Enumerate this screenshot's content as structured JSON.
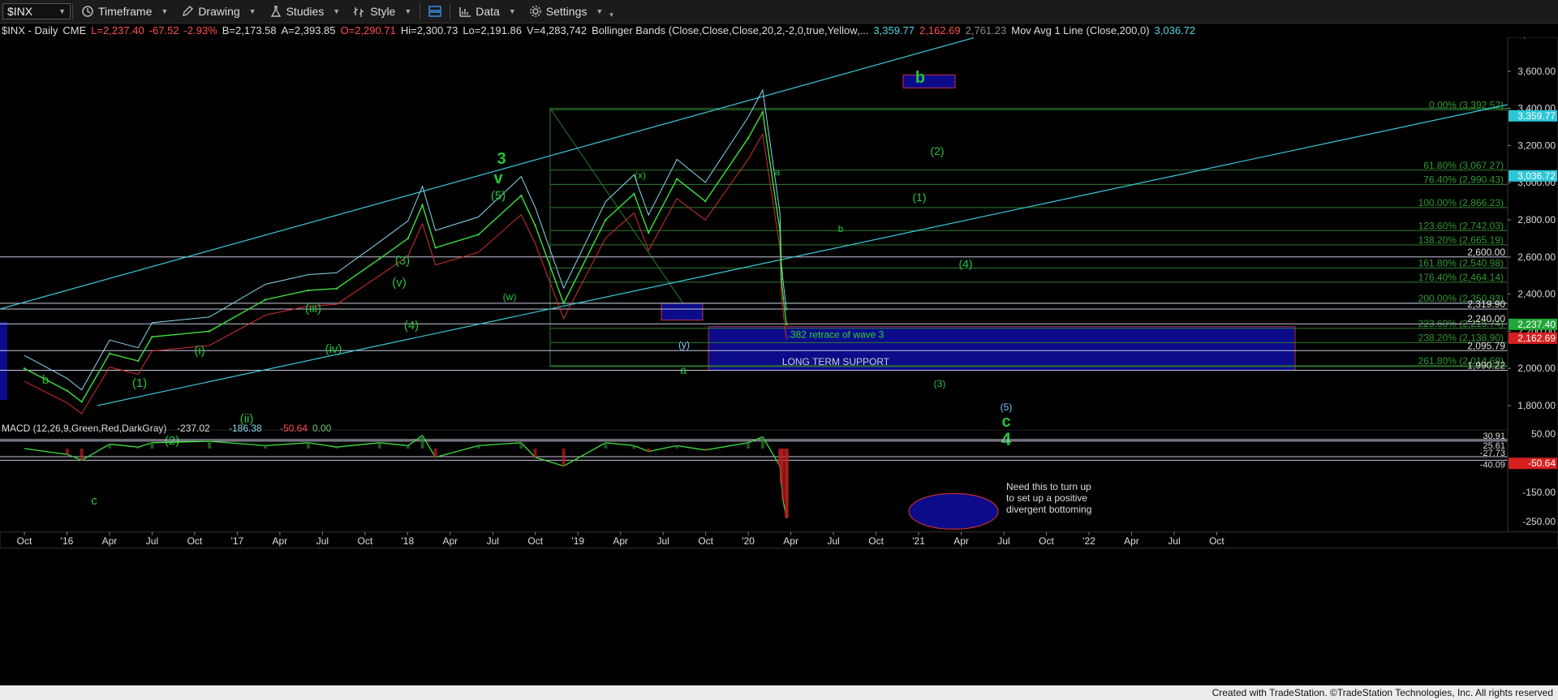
{
  "toolbar": {
    "symbol": "$INX",
    "items": [
      "Timeframe",
      "Drawing",
      "Studies",
      "Style",
      "Data",
      "Settings"
    ]
  },
  "infobar": {
    "symbol_line": "$INX - Daily",
    "exchange": "CME",
    "last": "L=2,237.40",
    "change": "-67.52",
    "change_pct": "-2.93%",
    "bid": "B=2,173.58",
    "ask": "A=2,393.85",
    "open": "O=2,290.71",
    "high": "Hi=2,300.73",
    "low": "Lo=2,191.86",
    "volume": "V=4,283,742",
    "bb_label": "Bollinger Bands (Close,Close,Close,20,2,-2,0,true,Yellow,...",
    "bb_upper": "3,359.77",
    "bb_lower": "2,162.69",
    "bb_mid": "2,761.23",
    "ma_label": "Mov Avg 1 Line (Close,200,0)",
    "ma_value": "3,036.72"
  },
  "price_axis": {
    "ticks": [
      3800,
      3600,
      3400,
      3200,
      3000,
      2800,
      2600,
      2400,
      2200,
      2000,
      1800
    ],
    "tick_labels": [
      "3,800.00",
      "3,600.00",
      "3,400.00",
      "3,200.00",
      "3,000.00",
      "2,800.00",
      "2,600.00",
      "2,400.00",
      "2,200.00",
      "2,000.00",
      "1,800.00"
    ],
    "tags": [
      {
        "value": 3359.77,
        "label": "3,359.77",
        "color": "#2ec6d6"
      },
      {
        "value": 3036.72,
        "label": "3,036.72",
        "color": "#2ec6d6"
      },
      {
        "value": 2237.4,
        "label": "2,237.40",
        "color": "#22a83a"
      },
      {
        "value": 2162.69,
        "label": "2,162.69",
        "color": "#d62020"
      }
    ]
  },
  "macd_axis": {
    "ticks": [
      50,
      -50,
      -150,
      -250
    ],
    "tick_labels": [
      "50.00",
      "-50.00",
      "-150.00",
      "-250.00"
    ],
    "level_labels": [
      "30.91",
      "25.61",
      "-27.73",
      "-40.09"
    ],
    "tag": {
      "value": -50.64,
      "label": "-50.64",
      "color": "#d62020"
    }
  },
  "time_axis": {
    "labels": [
      "Oct",
      "'16",
      "Apr",
      "Jul",
      "Oct",
      "'17",
      "Apr",
      "Jul",
      "Oct",
      "'18",
      "Apr",
      "Jul",
      "Oct",
      "'19",
      "Apr",
      "Jul",
      "Oct",
      "'20",
      "Apr",
      "Jul",
      "Oct",
      "'21",
      "Apr",
      "Jul",
      "Oct",
      "'22",
      "Apr",
      "Jul",
      "Oct"
    ]
  },
  "fib_levels": [
    {
      "label": "0.00% (3,392.52)",
      "value": 3392.52
    },
    {
      "label": "61.80% (3,067.27)",
      "value": 3067.27
    },
    {
      "label": "76.40% (2,990.43)",
      "value": 2990.43
    },
    {
      "label": "100.00% (2,866.23)",
      "value": 2866.23
    },
    {
      "label": "123.60% (2,742.03)",
      "value": 2742.03
    },
    {
      "label": "138.20% (2,665.19)",
      "value": 2665.19
    },
    {
      "label": "161.80% (2,540.98)",
      "value": 2540.98
    },
    {
      "label": "176.40% (2,464.14)",
      "value": 2464.14
    },
    {
      "label": "200.00% (2,350.93)",
      "value": 2350.93
    },
    {
      "label": "223.60% (2,215.74)",
      "value": 2215.74
    },
    {
      "label": "238.20% (2,138.90)",
      "value": 2138.9
    },
    {
      "label": "261.80% (2,014.69)",
      "value": 2014.69
    }
  ],
  "support_lines": [
    {
      "label": "2,600.00",
      "value": 2600.0
    },
    {
      "label": "2,319.90",
      "value": 2319.9
    },
    {
      "label": "2,240.00",
      "value": 2240.0
    },
    {
      "label": "2,095.79",
      "value": 2095.79
    },
    {
      "label": "1,990.22",
      "value": 1990.22
    }
  ],
  "annotations": {
    "retrace": ".382 retrace of wave 3",
    "support": "LONG TERM SUPPORT",
    "macd_note": [
      "Need this to turn up",
      "to set up a positive",
      "divergent bottoming"
    ],
    "macd_label": "MACD (12,26,9,Green,Red,DarkGray)",
    "macd_v1": "-237.02",
    "macd_v2": "-186.38",
    "macd_v3": "-50.64",
    "macd_v4": "0.00"
  },
  "wave_labels": [
    {
      "t": "3",
      "x": 618,
      "y": 202,
      "size": 20,
      "color": "#22c53a"
    },
    {
      "t": "v",
      "x": 614,
      "y": 226,
      "size": 20,
      "color": "#22c53a"
    },
    {
      "t": "(5)",
      "x": 614,
      "y": 246,
      "size": 15,
      "color": "#22c53a"
    },
    {
      "t": "(3)",
      "x": 496,
      "y": 326,
      "size": 15,
      "color": "#22c53a"
    },
    {
      "t": "(v)",
      "x": 492,
      "y": 353,
      "size": 15,
      "color": "#22c53a"
    },
    {
      "t": "(iii)",
      "x": 386,
      "y": 385,
      "size": 15,
      "color": "#22c53a"
    },
    {
      "t": "(4)",
      "x": 507,
      "y": 406,
      "size": 15,
      "color": "#22c53a"
    },
    {
      "t": "(iv)",
      "x": 411,
      "y": 435,
      "size": 15,
      "color": "#22c53a"
    },
    {
      "t": "(i)",
      "x": 246,
      "y": 437,
      "size": 15,
      "color": "#22c53a"
    },
    {
      "t": "(1)",
      "x": 172,
      "y": 477,
      "size": 15,
      "color": "#22c53a"
    },
    {
      "t": "b",
      "x": 56,
      "y": 473,
      "size": 15,
      "color": "#22c53a"
    },
    {
      "t": "(2)",
      "x": 212,
      "y": 548,
      "size": 15,
      "color": "#22c53a"
    },
    {
      "t": "(ii)",
      "x": 304,
      "y": 521,
      "size": 15,
      "color": "#22c53a"
    },
    {
      "t": "c",
      "x": 116,
      "y": 622,
      "size": 15,
      "color": "#22c53a"
    },
    {
      "t": "(w)",
      "x": 628,
      "y": 370,
      "size": 12,
      "color": "#22c53a"
    },
    {
      "t": "(x)",
      "x": 789,
      "y": 220,
      "size": 12,
      "color": "#22c53a"
    },
    {
      "t": "(y)",
      "x": 843,
      "y": 429,
      "size": 12,
      "color": "#7ec8ff"
    },
    {
      "t": "a",
      "x": 842,
      "y": 461,
      "size": 14,
      "color": "#22c53a"
    },
    {
      "t": "a",
      "x": 958,
      "y": 216,
      "size": 12,
      "color": "#22c53a"
    },
    {
      "t": "b",
      "x": 1036,
      "y": 286,
      "size": 12,
      "color": "#22c53a"
    },
    {
      "t": "b",
      "x": 1134,
      "y": 102,
      "size": 20,
      "color": "#22c53a"
    },
    {
      "t": "(2)",
      "x": 1155,
      "y": 191,
      "size": 14,
      "color": "#22c53a"
    },
    {
      "t": "(1)",
      "x": 1133,
      "y": 248,
      "size": 14,
      "color": "#22c53a"
    },
    {
      "t": "(4)",
      "x": 1190,
      "y": 330,
      "size": 14,
      "color": "#22c53a"
    },
    {
      "t": "(3)",
      "x": 1158,
      "y": 477,
      "size": 12,
      "color": "#22c53a"
    },
    {
      "t": "(5)",
      "x": 1240,
      "y": 506,
      "size": 12,
      "color": "#7ec8ff"
    },
    {
      "t": "c",
      "x": 1240,
      "y": 526,
      "size": 20,
      "color": "#22c53a"
    },
    {
      "t": "4",
      "x": 1240,
      "y": 549,
      "size": 22,
      "color": "#22c53a"
    }
  ],
  "chart_data": {
    "type": "line",
    "title": "$INX - Daily",
    "xlabel": "",
    "ylabel": "",
    "ylim": [
      1700,
      3850
    ],
    "x": [
      "2015-10",
      "2016-01",
      "2016-02",
      "2016-04",
      "2016-06",
      "2016-07",
      "2016-11",
      "2017-03",
      "2017-06",
      "2017-08",
      "2017-11",
      "2018-01",
      "2018-02",
      "2018-03",
      "2018-06",
      "2018-09",
      "2018-10",
      "2018-12",
      "2019-03",
      "2019-05",
      "2019-06",
      "2019-08",
      "2019-10",
      "2020-01",
      "2020-02",
      "2020-03-09",
      "2020-03-12",
      "2020-03-16",
      "2020-03-23",
      "2020-03-24"
    ],
    "series": [
      {
        "values": [
          2000,
          1880,
          1820,
          2080,
          2040,
          2170,
          2200,
          2370,
          2420,
          2430,
          2590,
          2700,
          2880,
          2650,
          2720,
          2930,
          2770,
          2350,
          2800,
          2940,
          2730,
          3020,
          2900,
          3240,
          3380,
          2740,
          2480,
          2380,
          2237,
          2237
        ]
      }
    ],
    "macd": {
      "values": [
        0,
        -20,
        -40,
        15,
        5,
        20,
        25,
        10,
        20,
        5,
        20,
        10,
        45,
        -30,
        10,
        20,
        -30,
        -60,
        20,
        10,
        -10,
        10,
        -5,
        20,
        40,
        -60,
        -120,
        -180,
        -237,
        -237
      ]
    },
    "grid": false
  },
  "footer": "Created with TradeStation. ©TradeStation Technologies, Inc. All rights reserved"
}
